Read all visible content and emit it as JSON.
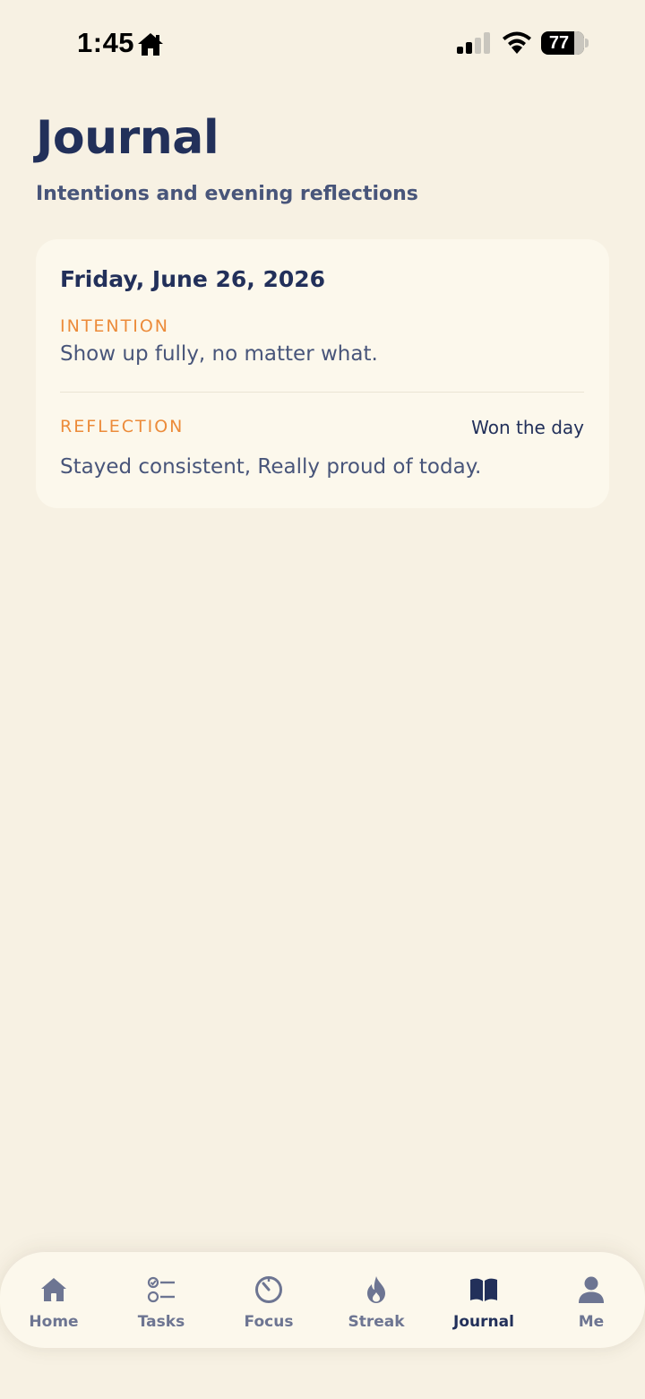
{
  "status_bar": {
    "time": "1:45",
    "battery_level": "77"
  },
  "header": {
    "title": "Journal",
    "subtitle": "Intentions and evening reflections"
  },
  "entry": {
    "date": "Friday, June 26, 2026",
    "intention_label": "INTENTION",
    "intention_text": "Show up fully, no matter what.",
    "reflection_label": "REFLECTION",
    "reflection_badge": "Won the day",
    "reflection_text": "Stayed consistent, Really proud of today."
  },
  "nav": {
    "items": [
      {
        "label": "Home",
        "icon": "home-icon"
      },
      {
        "label": "Tasks",
        "icon": "tasks-icon"
      },
      {
        "label": "Focus",
        "icon": "timer-icon"
      },
      {
        "label": "Streak",
        "icon": "flame-icon"
      },
      {
        "label": "Journal",
        "icon": "book-icon",
        "active": true
      },
      {
        "label": "Me",
        "icon": "person-icon"
      }
    ]
  },
  "colors": {
    "background": "#f7f1e3",
    "card": "#fcf8ec",
    "primary": "#22305a",
    "secondary_text": "#48557a",
    "accent": "#ec8b3a",
    "nav_inactive": "#6d7592"
  }
}
